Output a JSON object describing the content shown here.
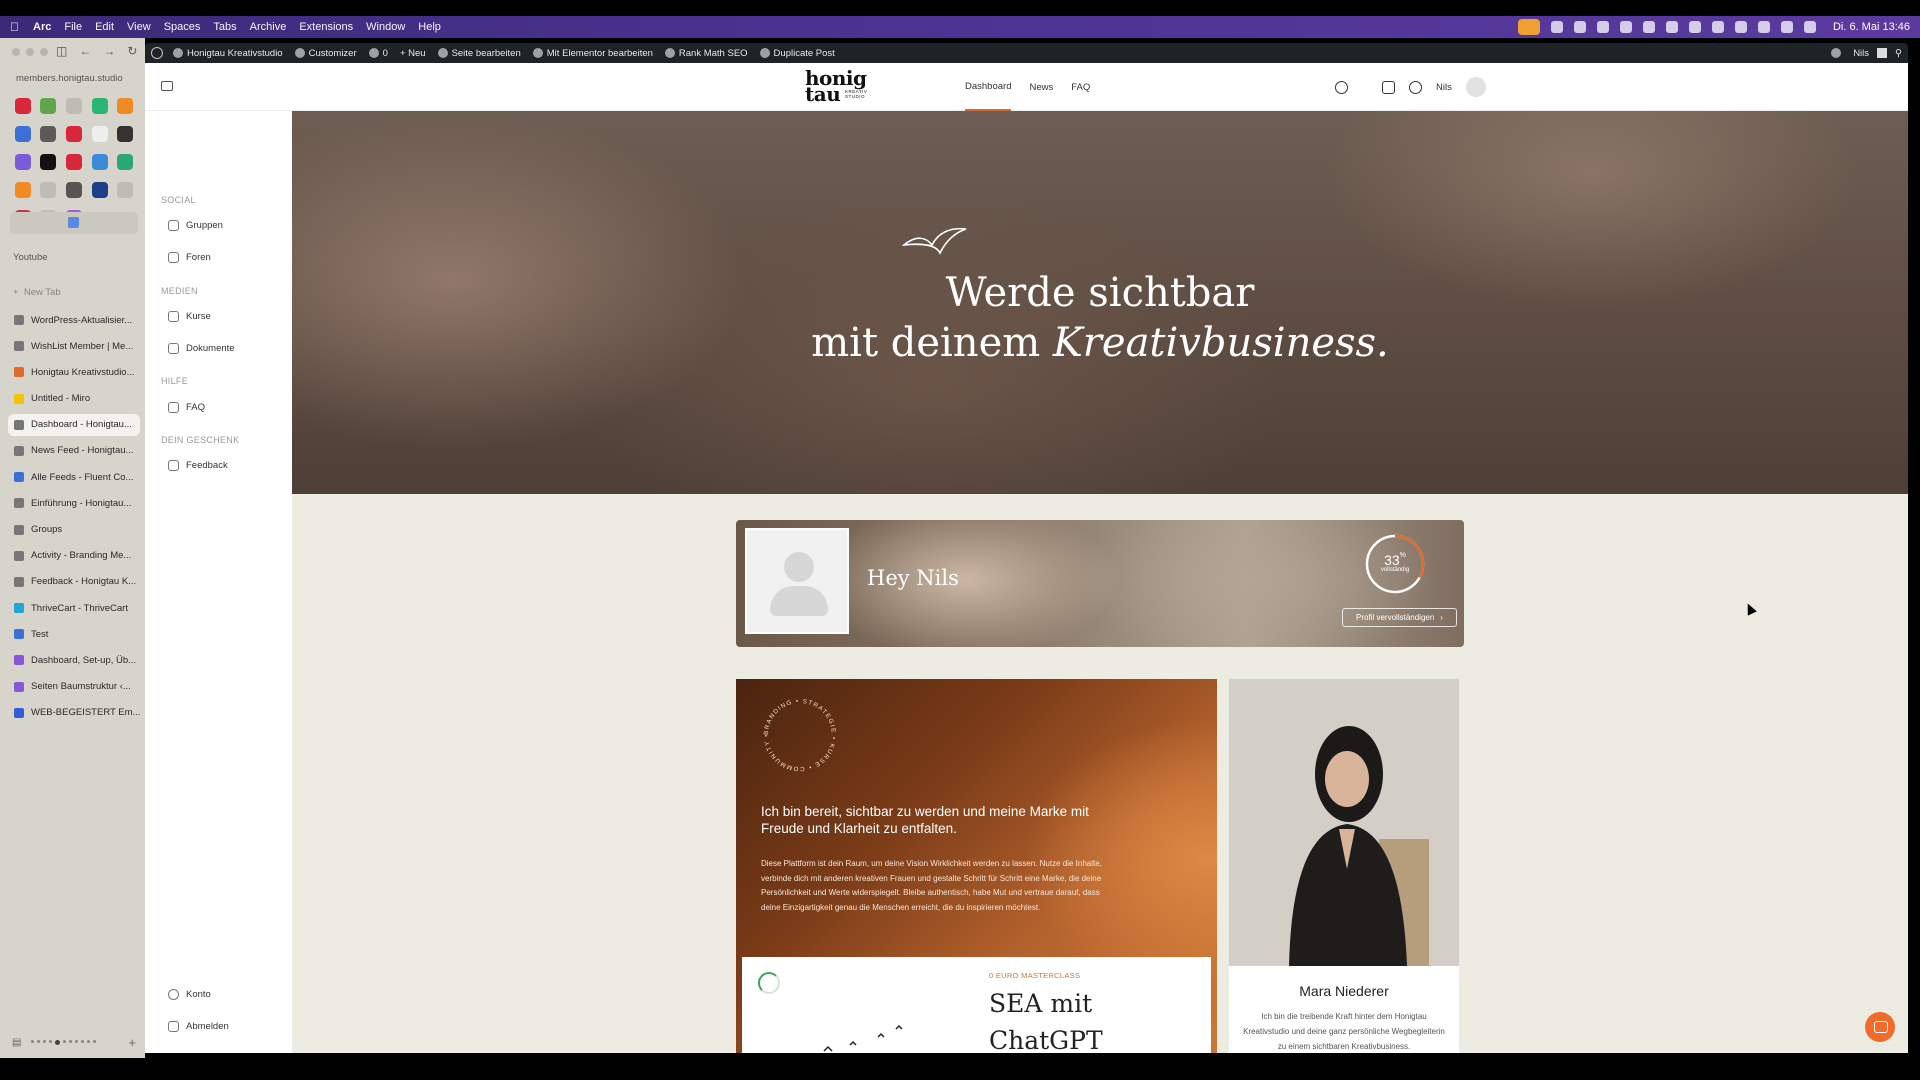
{
  "menubar": {
    "items": [
      "Arc",
      "File",
      "Edit",
      "View",
      "Spaces",
      "Tabs",
      "Archive",
      "Extensions",
      "Window",
      "Help"
    ],
    "clock": "Di. 6. Mai 13:46"
  },
  "arc": {
    "url": "members.honigtau.studio",
    "space_label": "Youtube",
    "new_tab": "New Tab",
    "tabs": [
      {
        "label": "WordPress-Aktualisier...",
        "color": "#777"
      },
      {
        "label": "WishList Member | Me...",
        "color": "#777"
      },
      {
        "label": "Honigtau Kreativstudio...",
        "color": "#e0692b"
      },
      {
        "label": "Untitled - Miro",
        "color": "#f5c400"
      },
      {
        "label": "Dashboard - Honigtau...",
        "color": "#777"
      },
      {
        "label": "News Feed - Honigtau...",
        "color": "#777"
      },
      {
        "label": "Alle Feeds - Fluent Co...",
        "color": "#3c6fd8"
      },
      {
        "label": "Einführung - Honigtau...",
        "color": "#777"
      },
      {
        "label": "Groups",
        "color": "#777"
      },
      {
        "label": "Activity - Branding Me...",
        "color": "#777"
      },
      {
        "label": "Feedback - Honigtau K...",
        "color": "#777"
      },
      {
        "label": "ThriveCart - ThriveCart",
        "color": "#1fa6d8"
      },
      {
        "label": "Test",
        "color": "#3c6fd8"
      },
      {
        "label": "Dashboard, Set-up, Üb...",
        "color": "#8a56d8"
      },
      {
        "label": "Seiten Baumstruktur ‹...",
        "color": "#8a56d8"
      },
      {
        "label": "WEB-BEGEISTERT Em...",
        "color": "#2d5fd8"
      }
    ]
  },
  "wpbar": {
    "site": "Honigtau Kreativstudio",
    "customizer": "Customizer",
    "comments": "0",
    "new": "Neu",
    "edit_page": "Seite bearbeiten",
    "elementor": "Mit Elementor bearbeiten",
    "rankmath": "Rank Math SEO",
    "duplicate": "Duplicate Post",
    "user": "Nils"
  },
  "header": {
    "logo_main": "honig tau",
    "logo_sub": "KREATIV STUDIO",
    "nav": [
      "Dashboard",
      "News",
      "FAQ"
    ],
    "user": "Nils"
  },
  "leftnav": {
    "groups": [
      {
        "label": "SOCIAL",
        "links": [
          "Gruppen",
          "Foren"
        ]
      },
      {
        "label": "MEDIEN",
        "links": [
          "Kurse",
          "Dokumente"
        ]
      },
      {
        "label": "HILFE",
        "links": [
          "FAQ"
        ]
      },
      {
        "label": "DEIN GESCHENK",
        "links": [
          "Feedback"
        ]
      }
    ],
    "bottom": [
      "Konto",
      "Abmelden"
    ]
  },
  "hero": {
    "line1": "Werde sichtbar",
    "line2_plain": "mit deinem ",
    "line2_italic": "Kreativbusiness."
  },
  "profile": {
    "greeting": "Hey Nils",
    "completion_value": "33",
    "completion_pct": 0.33,
    "completion_unit": "%",
    "completion_label": "vollständig",
    "button": "Profil vervollständigen"
  },
  "promo": {
    "seal_text": "BRANDING • STRATEGIE • KURSE • COMMUNITY •",
    "headline": "Ich bin bereit, sichtbar zu werden und meine Marke mit Freude und Klarheit zu entfalten.",
    "body": "Diese Plattform ist dein Raum, um deine Vision Wirklichkeit werden zu lassen. Nutze die Inhalte, verbinde dich mit anderen kreativen Frauen und gestalte Schritt für Schritt eine Marke, die deine Persönlichkeit und Werte widerspiegelt. Bleibe authentisch, habe Mut und vertraue darauf, dass deine Einzigartigkeit genau die Menschen erreicht, die du inspirieren möchtest.",
    "tag": "0 EURO MASTERCLASS",
    "title": "SEA mit ChatGPT"
  },
  "person": {
    "name": "Mara Niederer",
    "bio": "Ich bin die treibende Kraft hinter dem Honigtau Kreativstudio und deine ganz persönliche Wegbegleiterin zu einem sichtbaren Kreativbusiness."
  },
  "colors": {
    "accent": "#d06c33",
    "wpbar": "#1d2327",
    "page_bg": "#ecece3"
  }
}
